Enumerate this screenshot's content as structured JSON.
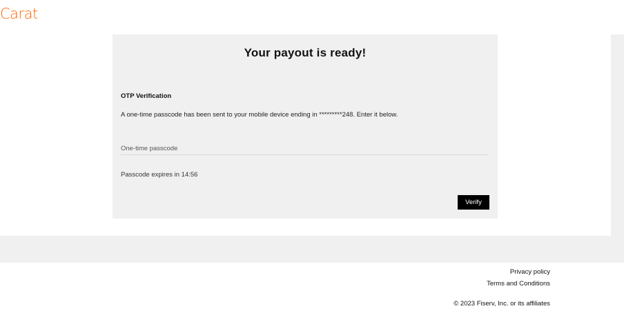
{
  "header": {
    "logo_text": "Carat",
    "brand_color": "#ff6600"
  },
  "card": {
    "title": "Your payout is ready!",
    "otp_heading": "OTP Verification",
    "otp_description": "A one-time passcode has been sent to your mobile device ending in *********248. Enter it below.",
    "passcode_placeholder": "One-time passcode",
    "passcode_value": "",
    "expires_text": "Passcode expires in 14:56",
    "verify_label": "Verify"
  },
  "footer": {
    "privacy_label": "Privacy policy",
    "terms_label": "Terms and Conditions",
    "copyright": "© 2023 Fiserv, Inc. or its affiliates"
  }
}
